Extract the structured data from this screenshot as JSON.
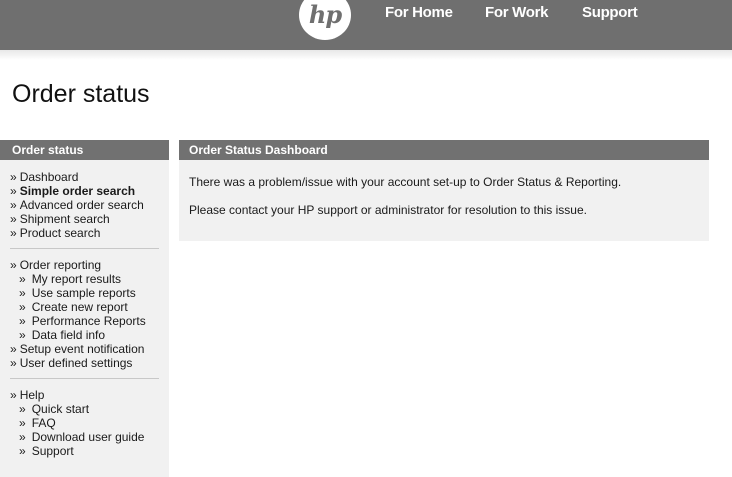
{
  "header": {
    "logo_text": "hp",
    "nav": [
      "For Home",
      "For Work",
      "Support"
    ]
  },
  "page": {
    "title": "Order status"
  },
  "sidebar": {
    "title": "Order status",
    "groups": [
      [
        {
          "label": "Dashboard",
          "level": 1,
          "bullet": "»"
        },
        {
          "label": "Simple order search",
          "level": 1,
          "bullet": "»",
          "active": true
        },
        {
          "label": "Advanced order search",
          "level": 1,
          "bullet": "»"
        },
        {
          "label": "Shipment search",
          "level": 1,
          "bullet": "»"
        },
        {
          "label": "Product search",
          "level": 1,
          "bullet": "»"
        }
      ],
      [
        {
          "label": "Order reporting",
          "level": 1,
          "bullet": "»"
        },
        {
          "label": "My report results",
          "level": 2,
          "bullet": "»"
        },
        {
          "label": "Use sample reports",
          "level": 2,
          "bullet": "»"
        },
        {
          "label": "Create new report",
          "level": 2,
          "bullet": "»"
        },
        {
          "label": "Performance Reports",
          "level": 2,
          "bullet": "»"
        },
        {
          "label": "Data field info",
          "level": 2,
          "bullet": "»"
        },
        {
          "label": "Setup event notification",
          "level": 1,
          "bullet": "»"
        },
        {
          "label": "User defined settings",
          "level": 1,
          "bullet": "»"
        }
      ],
      [
        {
          "label": "Help",
          "level": 1,
          "bullet": "»"
        },
        {
          "label": "Quick start",
          "level": 2,
          "bullet": "»"
        },
        {
          "label": "FAQ",
          "level": 2,
          "bullet": "»"
        },
        {
          "label": "Download user guide",
          "level": 2,
          "bullet": "»"
        },
        {
          "label": "Support",
          "level": 2,
          "bullet": "»"
        }
      ]
    ]
  },
  "main": {
    "title": "Order Status Dashboard",
    "message1": "There was a problem/issue with your account set-up to Order Status & Reporting.",
    "message2": "Please contact your HP support or administrator for resolution to this issue."
  },
  "colors": {
    "topbar": "#6f6f6f",
    "section_header": "#717171",
    "panel_background": "#f1f1f1"
  }
}
